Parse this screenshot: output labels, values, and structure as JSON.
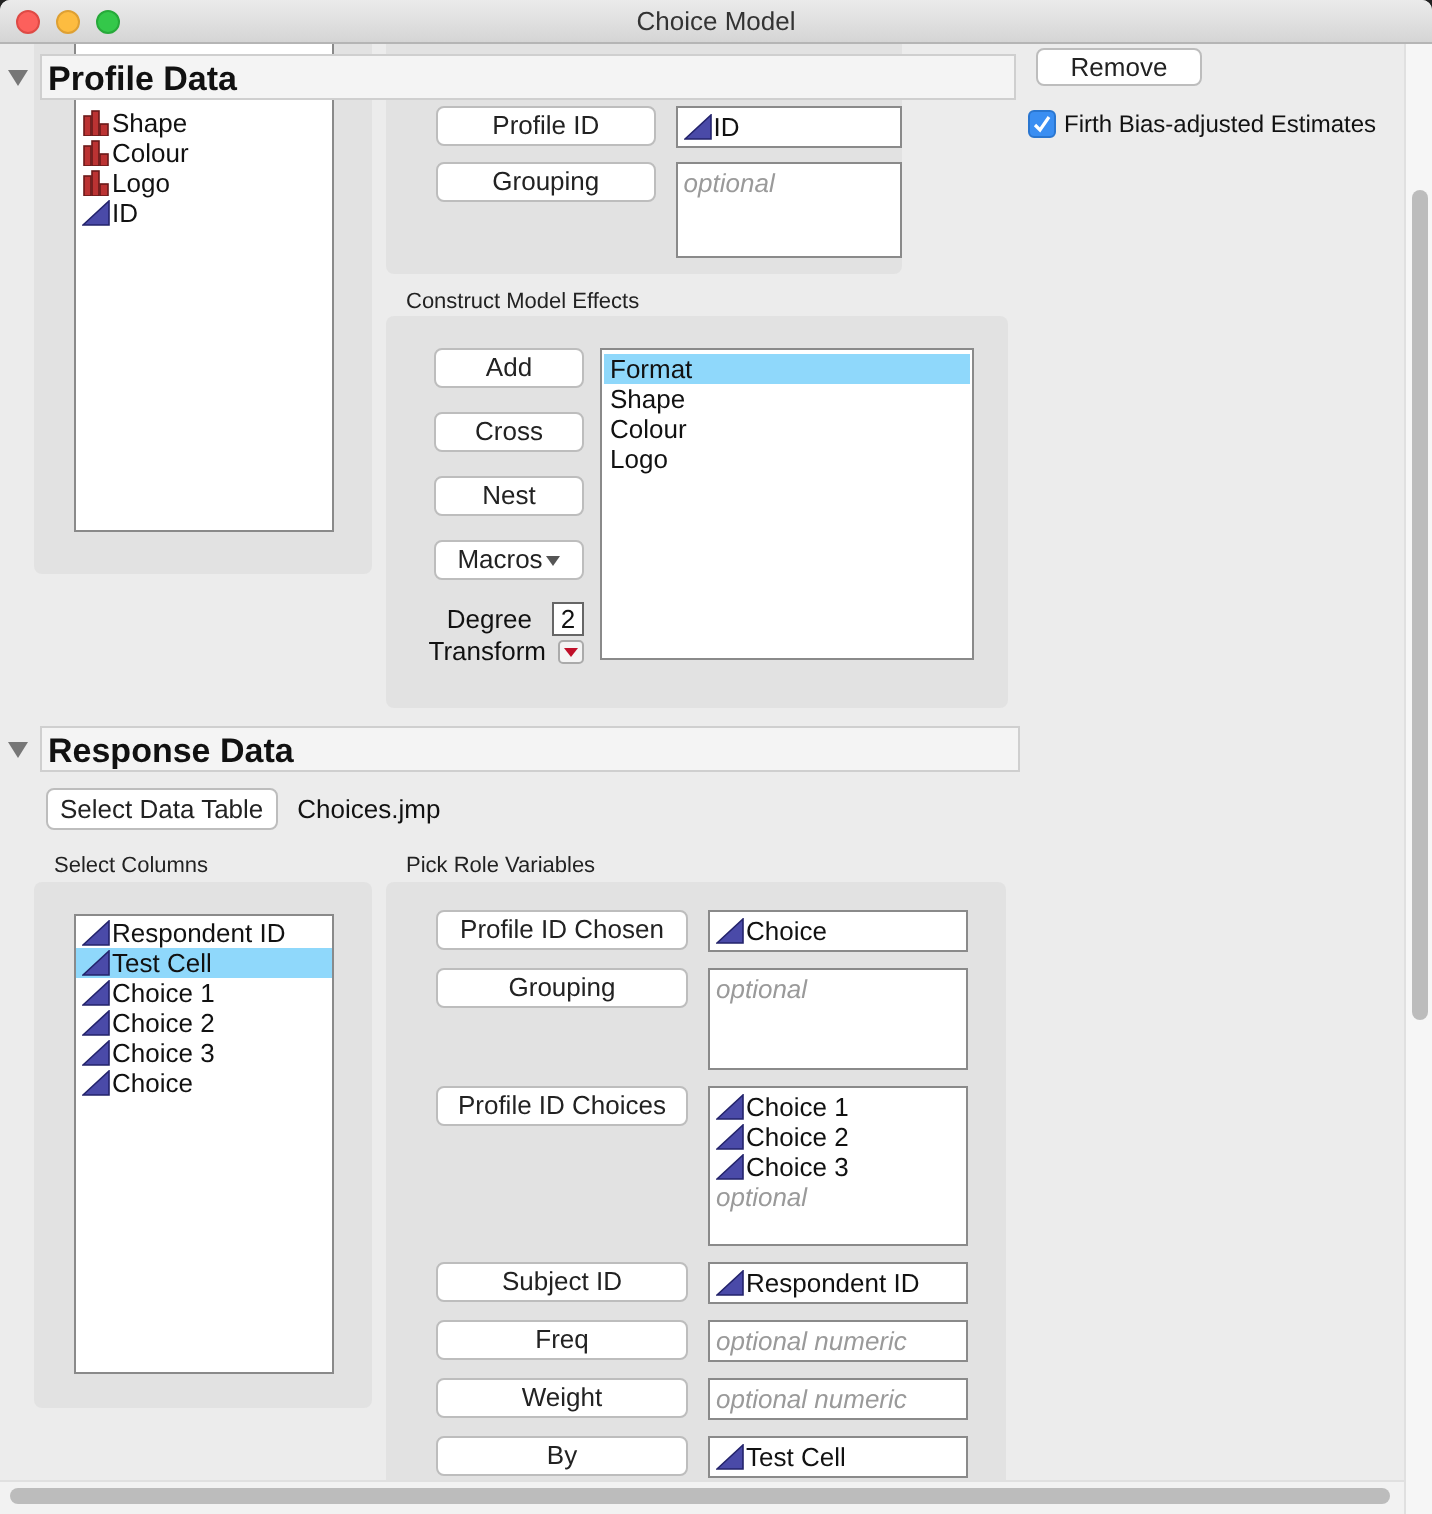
{
  "window": {
    "title": "Choice Model"
  },
  "profile_data": {
    "title": "Profile Data",
    "expanded": true,
    "columns": [
      {
        "name": "Shape",
        "kind": "nominal"
      },
      {
        "name": "Colour",
        "kind": "nominal"
      },
      {
        "name": "Logo",
        "kind": "nominal"
      },
      {
        "name": "ID",
        "kind": "continuous"
      }
    ],
    "roles": [
      {
        "button": "Profile ID",
        "kind": "single",
        "values": [
          {
            "name": "ID",
            "kind": "continuous"
          }
        ]
      },
      {
        "button": "Grouping",
        "kind": "list",
        "placeholder": "optional"
      }
    ]
  },
  "construct_model_effects": {
    "title": "Construct Model Effects",
    "buttons": [
      {
        "label": "Add",
        "kind": "button"
      },
      {
        "label": "Cross",
        "kind": "button"
      },
      {
        "label": "Nest",
        "kind": "button"
      },
      {
        "label": "Macros",
        "kind": "menu"
      }
    ],
    "degree_label": "Degree",
    "degree": "2",
    "transform_label": "Transform",
    "effects": [
      {
        "name": "Format",
        "selected": true
      },
      {
        "name": "Shape",
        "selected": false
      },
      {
        "name": "Colour",
        "selected": false
      },
      {
        "name": "Logo",
        "selected": false
      }
    ]
  },
  "response_data": {
    "title": "Response Data",
    "expanded": true,
    "select_button": "Select Data Table",
    "table_name": "Choices.jmp",
    "select_columns_title": "Select Columns",
    "columns": [
      {
        "name": "Respondent ID",
        "kind": "continuous",
        "selected": false
      },
      {
        "name": "Test Cell",
        "kind": "continuous",
        "selected": true
      },
      {
        "name": "Choice 1",
        "kind": "continuous",
        "selected": false
      },
      {
        "name": "Choice 2",
        "kind": "continuous",
        "selected": false
      },
      {
        "name": "Choice 3",
        "kind": "continuous",
        "selected": false
      },
      {
        "name": "Choice",
        "kind": "continuous",
        "selected": false
      }
    ],
    "pick_roles_title": "Pick Role Variables",
    "roles": [
      {
        "button": "Profile ID Chosen",
        "kind": "single",
        "values": [
          {
            "name": "Choice",
            "kind": "continuous"
          }
        ]
      },
      {
        "button": "Grouping",
        "kind": "list",
        "placeholder": "optional"
      },
      {
        "button": "Profile ID Choices",
        "kind": "list",
        "values": [
          {
            "name": "Choice 1",
            "kind": "continuous"
          },
          {
            "name": "Choice 2",
            "kind": "continuous"
          },
          {
            "name": "Choice 3",
            "kind": "continuous"
          }
        ],
        "placeholder": "optional"
      },
      {
        "button": "Subject ID",
        "kind": "single",
        "values": [
          {
            "name": "Respondent ID",
            "kind": "continuous"
          }
        ]
      },
      {
        "button": "Freq",
        "kind": "single",
        "placeholder": "optional numeric"
      },
      {
        "button": "Weight",
        "kind": "single",
        "placeholder": "optional numeric"
      },
      {
        "button": "By",
        "kind": "single",
        "values": [
          {
            "name": "Test Cell",
            "kind": "continuous"
          }
        ]
      }
    ]
  },
  "options": {
    "remove_button": "Remove",
    "firth": {
      "label": "Firth Bias-adjusted Estimates",
      "checked": true
    }
  }
}
